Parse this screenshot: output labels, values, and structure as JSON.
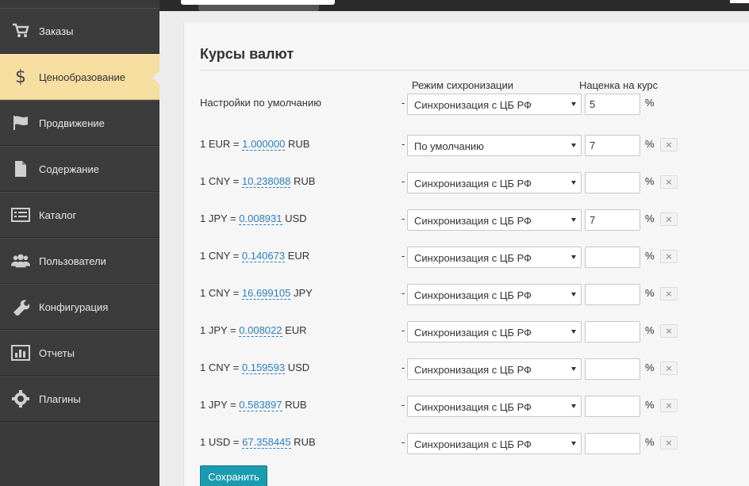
{
  "sidebar": {
    "items": [
      {
        "label": "Заказы",
        "icon": "cart-icon",
        "active": false
      },
      {
        "label": "Ценообразование",
        "icon": "dollar-icon",
        "active": true
      },
      {
        "label": "Продвижение",
        "icon": "flag-icon",
        "active": false
      },
      {
        "label": "Содержание",
        "icon": "document-icon",
        "active": false
      },
      {
        "label": "Каталог",
        "icon": "catalog-list-icon",
        "active": false
      },
      {
        "label": "Пользователи",
        "icon": "users-icon",
        "active": false
      },
      {
        "label": "Конфигурация",
        "icon": "wrench-icon",
        "active": false
      },
      {
        "label": "Отчеты",
        "icon": "bar-chart-icon",
        "active": false
      },
      {
        "label": "Плагины",
        "icon": "gear-icon",
        "active": false
      }
    ]
  },
  "main": {
    "title": "Курсы валют",
    "col_sync": "Режим сихронизации",
    "col_markup": "Наценка на курс",
    "default_row": {
      "label": "Настройки по умолчанию",
      "sync": "Синхронизация с ЦБ РФ",
      "markup": "5",
      "pct": "%"
    },
    "dash": "-",
    "rows": [
      {
        "prefix": "1 EUR = ",
        "rate": "1.000000",
        "suffix": " RUB",
        "sync": "По умолчанию",
        "markup": "7",
        "pct": "%"
      },
      {
        "prefix": "1 CNY = ",
        "rate": "10.238088",
        "suffix": " RUB",
        "sync": "Синхронизация с ЦБ РФ",
        "markup": "",
        "pct": "%"
      },
      {
        "prefix": "1 JPY = ",
        "rate": "0.008931",
        "suffix": " USD",
        "sync": "Синхронизация с ЦБ РФ",
        "markup": "7",
        "pct": "%"
      },
      {
        "prefix": "1 CNY = ",
        "rate": "0.140673",
        "suffix": " EUR",
        "sync": "Синхронизация с ЦБ РФ",
        "markup": "",
        "pct": "%"
      },
      {
        "prefix": "1 CNY = ",
        "rate": "16.699105",
        "suffix": " JPY",
        "sync": "Синхронизация с ЦБ РФ",
        "markup": "",
        "pct": "%"
      },
      {
        "prefix": "1 JPY = ",
        "rate": "0.008022",
        "suffix": " EUR",
        "sync": "Синхронизация с ЦБ РФ",
        "markup": "",
        "pct": "%"
      },
      {
        "prefix": "1 CNY = ",
        "rate": "0.159593",
        "suffix": " USD",
        "sync": "Синхронизация с ЦБ РФ",
        "markup": "",
        "pct": "%"
      },
      {
        "prefix": "1 JPY = ",
        "rate": "0.583897",
        "suffix": " RUB",
        "sync": "Синхронизация с ЦБ РФ",
        "markup": "",
        "pct": "%"
      },
      {
        "prefix": "1 USD = ",
        "rate": "67.358445",
        "suffix": " RUB",
        "sync": "Синхронизация с ЦБ РФ",
        "markup": "",
        "pct": "%"
      }
    ],
    "remove_label": "×",
    "save_label": "Сохранить"
  },
  "colors": {
    "sidebar_bg": "#3a3a3a",
    "active_item_bg": "#f5dea0",
    "link_blue": "#2a7fc1",
    "save_button": "#1b9bb0"
  }
}
